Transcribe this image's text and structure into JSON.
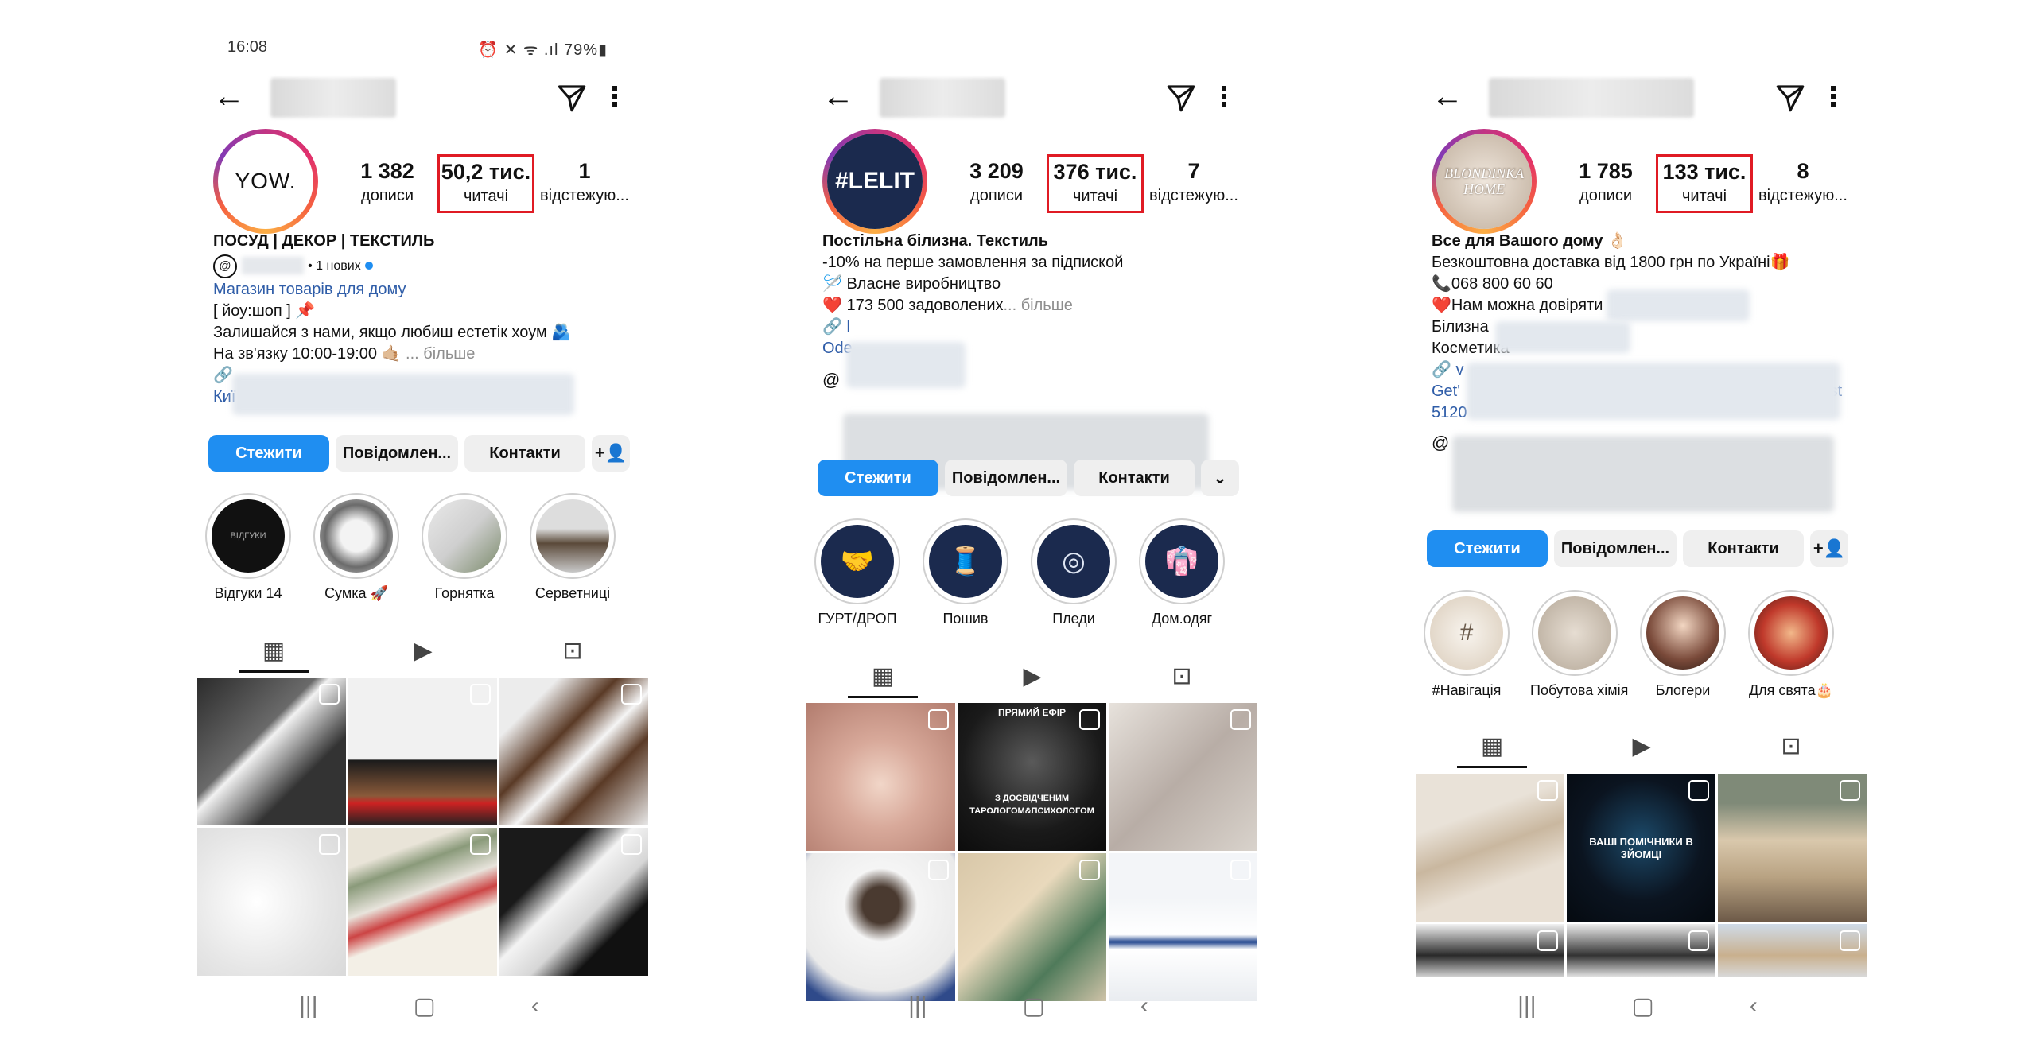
{
  "statusbar": {
    "time": "16:08",
    "system": "⏰ ✕ ᯤ .ıl 79%▮"
  },
  "profiles": [
    {
      "avatar_text": "YOW.",
      "stats": [
        {
          "num": "1 382",
          "label": "дописи"
        },
        {
          "num": "50,2 тис.",
          "label": "читачі"
        },
        {
          "num": "1",
          "label": "відстежую..."
        }
      ],
      "bio": {
        "title": "ПОСУД | ДЕКОР | ТЕКСТИЛЬ",
        "threads": "• 1 нових",
        "category": "Магазин товарів для дому",
        "line1": "[ йоу:шоп ] 📌",
        "line2": "Залишайся з нами, якщо любиш естетік хоум 🫂",
        "line3": "На зв'язку 10:00-19:00 🤙🏼",
        "more": "... більше",
        "city": "Киї"
      },
      "buttons": [
        "Стежити",
        "Повідомлен...",
        "Контакти",
        "+👤"
      ],
      "highlights": [
        "Відгуки 14",
        "Сумка 🚀",
        "Горнятка",
        "Серветниці"
      ]
    },
    {
      "avatar_text": "#LELIT",
      "stats": [
        {
          "num": "3 209",
          "label": "дописи"
        },
        {
          "num": "376 тис.",
          "label": "читачі"
        },
        {
          "num": "7",
          "label": "відстежую..."
        }
      ],
      "bio": {
        "title": "Постільна білизна. Текстиль",
        "line1": "-10% на перше замовлення за підпиской",
        "line2": "🪡 Власне виробництво",
        "line3": "❤️ 173 500 задоволених",
        "more": "... більше",
        "link1": "🔗 l",
        "link2": "Ode"
      },
      "buttons": [
        "Стежити",
        "Повідомлен...",
        "Контакти",
        "⌄"
      ],
      "highlights": [
        "ГУРТ/ДРОП",
        "Пошив",
        "Пледи",
        "Дом.одяг"
      ],
      "tile_texts": [
        "ПРЯМИЙ ЕФІР",
        "З ДОСВІДЧЕНИМ ТАРОЛОГОМ&ПСИХОЛОГОМ"
      ]
    },
    {
      "avatar_text": "BLONDINKA HOME",
      "stats": [
        {
          "num": "1 785",
          "label": "дописи"
        },
        {
          "num": "133 тис.",
          "label": "читачі"
        },
        {
          "num": "8",
          "label": "відстежую..."
        }
      ],
      "bio": {
        "title": "Все для Вашого дому 👌🏻",
        "line1": "Безкоштовна доставка від 1800 грн по Україні🎁",
        "line2": "📞068 800 60 60",
        "line3": "❤️Нам можна довіряти",
        "line4": "Білизна",
        "line5": "Косметика",
        "link1": "🔗 v",
        "link2": "Get'",
        "link3": "5120",
        "link_tail": "st"
      },
      "buttons": [
        "Стежити",
        "Повідомлен...",
        "Контакти",
        "+👤"
      ],
      "highlights": [
        "#Навігація",
        "Побутова хімія",
        "Блогери",
        "Для свята🎂"
      ],
      "tile_texts": [
        "ВАШІ ПОМІЧНИКИ В ЗЙОМЦІ"
      ]
    }
  ],
  "icons": {
    "back": "arrow-left-icon",
    "send": "paper-plane-icon",
    "more": "kebab-icon",
    "grid": "grid-icon",
    "reels": "reels-icon",
    "tagged": "tagged-icon",
    "reel_badge": "reel-badge-icon"
  },
  "colors": {
    "accent": "#1f8ef1",
    "highlight_box": "#e01b24",
    "link": "#2f5da8"
  },
  "navbar": {
    "recents": "|||",
    "home": "▢",
    "back": "‹"
  }
}
